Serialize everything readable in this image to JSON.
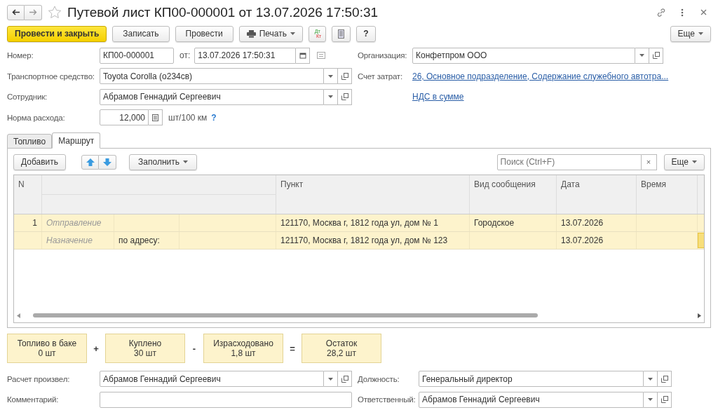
{
  "window": {
    "title": "Путевой лист КП00-000001 от 13.07.2026 17:50:31",
    "favorite": false
  },
  "toolbar": [
    {
      "kind": "primary",
      "label": "Провести и закрыть"
    },
    {
      "kind": "plain",
      "label": "Записать"
    },
    {
      "kind": "plain",
      "label": "Провести"
    },
    {
      "kind": "print",
      "label": "Печать"
    },
    {
      "kind": "dtkt",
      "label": "Дт",
      "sublabel": "Кт"
    },
    {
      "kind": "list"
    },
    {
      "kind": "help",
      "label": "?"
    },
    {
      "kind": "more",
      "label": "Еще"
    }
  ],
  "header": {
    "number": {
      "label": "Номер:",
      "value": "КП00-000001"
    },
    "date": {
      "label": "от:",
      "value": "13.07.2026 17:50:31"
    },
    "vehicle": {
      "label": "Транспортное средство:",
      "value": "Toyota Corolla (о234св)"
    },
    "employee": {
      "label": "Сотрудник:",
      "value": "Абрамов Геннадий Сергеевич"
    },
    "norm": {
      "label": "Норма расхода:",
      "value": "12,000",
      "unit": "шт/100 км",
      "help": "?"
    },
    "organization": {
      "label": "Организация:",
      "value": "Конфетпром ООО"
    },
    "cost_account": {
      "label": "Счет затрат:",
      "link": "26, Основное подразделение, Содержание служебного автотра..."
    },
    "vat_link": "НДС в сумме"
  },
  "tabs": [
    {
      "label": "Топливо",
      "selected": false
    },
    {
      "label": "Маршрут",
      "selected": true
    }
  ],
  "route_toolbar": {
    "add": "Добавить",
    "fill": "Заполнить",
    "search": {
      "placeholder": "Поиск (Ctrl+F)",
      "clear": "×"
    },
    "more": "Еще"
  },
  "table": {
    "columns": [
      "N",
      "Пункт",
      "Вид сообщения",
      "Дата",
      "Время"
    ],
    "rows": [
      {
        "n": "1",
        "type": "Отправление",
        "point": "121170, Москва г, 1812 года ул, дом № 1",
        "kind": "Городское",
        "date": "13.07.2026",
        "selected": true,
        "focused": false
      },
      {
        "type": "Назначение",
        "by": "по адресу:",
        "point": "121170, Москва г, 1812 года ул, дом № 123",
        "date": "13.07.2026",
        "selected": true,
        "focused": true
      }
    ]
  },
  "summary": [
    {
      "title": "Топливо в баке",
      "value": "0 шт",
      "op": "+"
    },
    {
      "title": "Куплено",
      "value": "30 шт",
      "op": "-"
    },
    {
      "title": "Израсходовано",
      "value": "1,8 шт",
      "op": "="
    },
    {
      "title": "Остаток",
      "value": "28,2 шт"
    }
  ],
  "footer": {
    "calculated_by": {
      "label": "Расчет произвел:",
      "value": "Абрамов Геннадий Сергеевич"
    },
    "position": {
      "label": "Должность:",
      "value": "Генеральный директор"
    },
    "comment": {
      "label": "Комментарий:"
    },
    "responsible": {
      "label": "Ответственный:",
      "value": "Абрамов Геннадий Сергеевич"
    }
  }
}
